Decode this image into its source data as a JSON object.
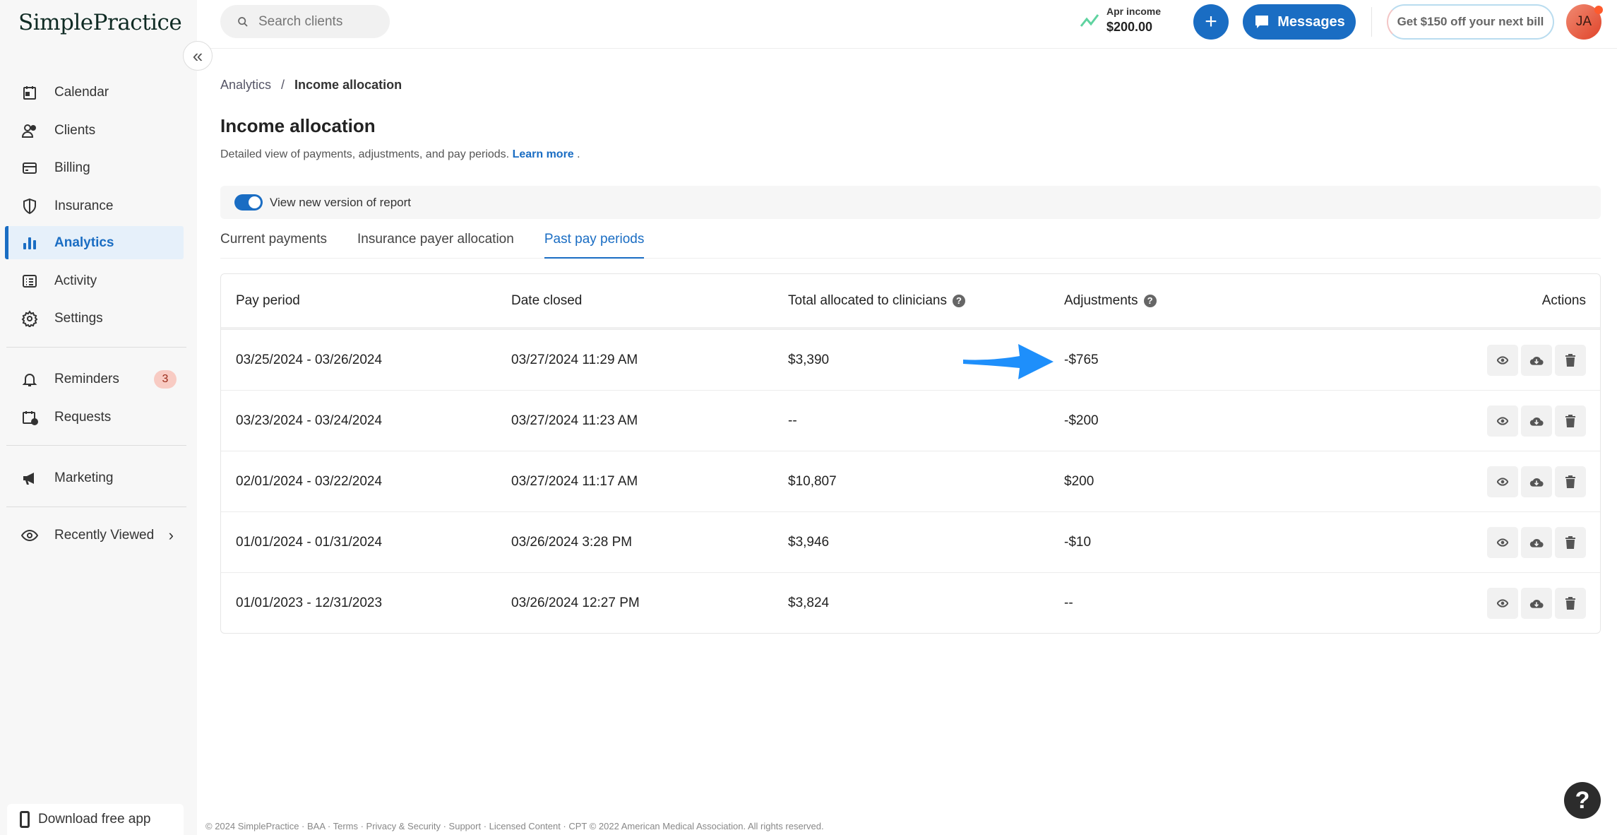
{
  "brand": {
    "logo": "SimplePractice"
  },
  "sidebar": {
    "items": [
      {
        "label": "Calendar",
        "icon": "calendar-icon"
      },
      {
        "label": "Clients",
        "icon": "clients-icon"
      },
      {
        "label": "Billing",
        "icon": "billing-icon"
      },
      {
        "label": "Insurance",
        "icon": "shield-icon"
      },
      {
        "label": "Analytics",
        "icon": "analytics-icon",
        "active": true
      },
      {
        "label": "Activity",
        "icon": "activity-icon"
      },
      {
        "label": "Settings",
        "icon": "gear-icon"
      }
    ],
    "reminders": {
      "label": "Reminders",
      "count": "3"
    },
    "requests": {
      "label": "Requests"
    },
    "marketing": {
      "label": "Marketing"
    },
    "recently_viewed": {
      "label": "Recently Viewed"
    },
    "download": "Download free app"
  },
  "topbar": {
    "search_placeholder": "Search clients",
    "income_label": "Apr income",
    "income_value": "$200.00",
    "plus": "+",
    "messages": "Messages",
    "promo": "Get $150 off your next bill",
    "avatar": "JA"
  },
  "breadcrumb": {
    "parent": "Analytics",
    "sep": "/",
    "current": "Income allocation"
  },
  "page": {
    "title": "Income allocation",
    "subtitle": "Detailed view of payments, adjustments, and pay periods.",
    "learn_more": "Learn more",
    "period": ".",
    "toggle_label": "View new version of report"
  },
  "tabs": [
    {
      "label": "Current payments"
    },
    {
      "label": "Insurance payer allocation"
    },
    {
      "label": "Past pay periods",
      "active": true
    }
  ],
  "table": {
    "headers": [
      "Pay period",
      "Date closed",
      "Total allocated to clinicians",
      "Adjustments",
      "Actions"
    ],
    "help_glyph": "?",
    "rows": [
      [
        "03/25/2024 - 03/26/2024",
        "03/27/2024 11:29 AM",
        "$3,390",
        "-$765"
      ],
      [
        "03/23/2024 - 03/24/2024",
        "03/27/2024 11:23 AM",
        "--",
        "-$200"
      ],
      [
        "02/01/2024 - 03/22/2024",
        "03/27/2024 11:17 AM",
        "$10,807",
        "$200"
      ],
      [
        "01/01/2024 - 01/31/2024",
        "03/26/2024 3:28 PM",
        "$3,946",
        "-$10"
      ],
      [
        "01/01/2023 - 12/31/2023",
        "03/26/2024 12:27 PM",
        "$3,824",
        "--"
      ]
    ]
  },
  "footer": "© 2024 SimplePractice · BAA · Terms · Privacy & Security · Support · Licensed Content · CPT © 2022 American Medical Association. All rights reserved.",
  "help": "?",
  "colors": {
    "accent": "#1a6dc3",
    "annotation_arrow": "#1e8ffb"
  }
}
